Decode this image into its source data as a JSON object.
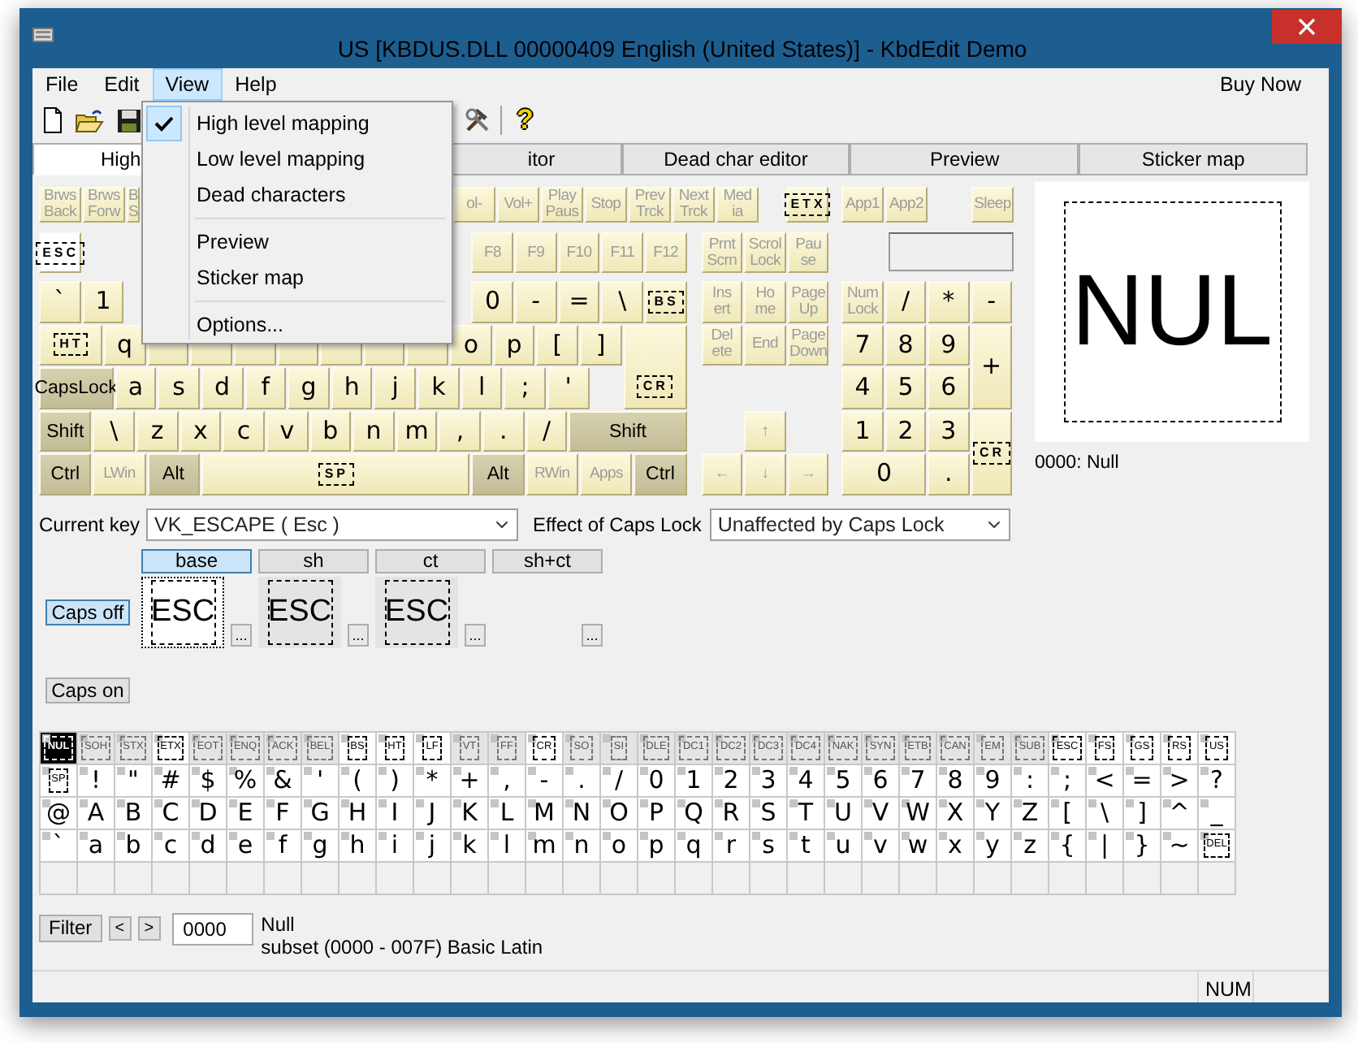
{
  "window": {
    "title": "US [KBDUS.DLL 00000409 English (United States)] - KbdEdit Demo"
  },
  "menu_bar": [
    {
      "label": "File",
      "selected": false
    },
    {
      "label": "Edit",
      "selected": false
    },
    {
      "label": "View",
      "selected": true
    },
    {
      "label": "Help",
      "selected": false
    }
  ],
  "buy_now": "Buy Now",
  "toolbar": {
    "help": "?"
  },
  "view_menu": [
    {
      "kind": "item",
      "label": "High level mapping",
      "checked": true
    },
    {
      "kind": "item",
      "label": "Low level mapping",
      "checked": false
    },
    {
      "kind": "item",
      "label": "Dead characters",
      "checked": false
    },
    {
      "kind": "separator"
    },
    {
      "kind": "item",
      "label": "Preview",
      "checked": false
    },
    {
      "kind": "item",
      "label": "Sticker map",
      "checked": false
    },
    {
      "kind": "separator"
    },
    {
      "kind": "item",
      "label": "Options...",
      "checked": false
    }
  ],
  "tabs": [
    {
      "label": "High",
      "selected": true
    },
    {
      "label": "itor",
      "selected": false
    },
    {
      "label": "Dead char editor",
      "selected": false
    },
    {
      "label": "Preview",
      "selected": false
    },
    {
      "label": "Sticker map",
      "selected": false
    }
  ],
  "keyboard": {
    "media_row": {
      "before_menu": [
        {
          "label": "Brws Back",
          "kind": "dim",
          "selected": false
        },
        {
          "label": "Brws Forw",
          "kind": "dim",
          "selected": false
        },
        {
          "label": "B S",
          "kind": "dim",
          "selected": false
        }
      ],
      "after_menu": [
        {
          "label": "ol-",
          "kind": "dim",
          "selected": false
        },
        {
          "label": "Vol+",
          "kind": "dim",
          "selected": false
        },
        {
          "label": "Play Paus",
          "kind": "dim",
          "selected": false
        },
        {
          "label": "Stop",
          "kind": "dim",
          "selected": false
        },
        {
          "label": "Prev Trck",
          "kind": "dim",
          "selected": false
        },
        {
          "label": "Next Trck",
          "kind": "dim",
          "selected": false
        },
        {
          "label": "Med ia",
          "kind": "dim",
          "selected": false
        }
      ],
      "nav": [
        {
          "label": "ETX",
          "kind": "sticker",
          "selected": false
        }
      ],
      "numpad": [
        {
          "label": "App1",
          "kind": "dim",
          "selected": false
        },
        {
          "label": "App2",
          "kind": "dim",
          "selected": false
        },
        {
          "label": "Sleep",
          "kind": "dim",
          "selected": false
        }
      ]
    },
    "main_rows": [
      {
        "keys": [
          {
            "label": "ESC",
            "kind": "sticker",
            "selected": true
          }
        ],
        "keys_after_menu": [
          {
            "label": "F8",
            "kind": "dim",
            "selected": false
          },
          {
            "label": "F9",
            "kind": "dim",
            "selected": false
          },
          {
            "label": "F10",
            "kind": "dim",
            "selected": false
          },
          {
            "label": "F11",
            "kind": "dim",
            "selected": false
          },
          {
            "label": "F12",
            "kind": "dim",
            "selected": false
          }
        ]
      },
      {
        "keys": [
          {
            "label": "`",
            "kind": "char",
            "selected": false
          },
          {
            "label": "1",
            "kind": "char",
            "selected": false
          }
        ],
        "keys_after_menu": [
          {
            "label": "0",
            "kind": "char",
            "selected": false
          },
          {
            "label": "-",
            "kind": "char",
            "selected": false
          },
          {
            "label": "=",
            "kind": "char",
            "selected": false
          },
          {
            "label": "\\",
            "kind": "char",
            "selected": false
          },
          {
            "label": "BS",
            "kind": "sticker",
            "selected": false
          }
        ]
      },
      {
        "keys": [
          {
            "label": "HT",
            "kind": "sticker",
            "selected": false
          },
          {
            "label": "q",
            "kind": "char",
            "selected": false
          },
          {
            "kind": "char",
            "selected": false
          },
          {
            "kind": "char",
            "selected": false
          },
          {
            "kind": "char",
            "selected": false
          },
          {
            "kind": "char",
            "selected": false
          },
          {
            "kind": "char",
            "selected": false
          },
          {
            "kind": "char",
            "selected": false
          },
          {
            "kind": "char",
            "selected": false
          },
          {
            "label": "o",
            "kind": "char",
            "selected": false
          },
          {
            "label": "p",
            "kind": "char",
            "selected": false
          },
          {
            "label": "[",
            "kind": "char",
            "selected": false
          },
          {
            "label": "]",
            "kind": "char",
            "selected": false
          },
          {
            "label": "CR",
            "kind": "sticker",
            "selected": false
          }
        ]
      },
      {
        "keys": [
          {
            "label": "CapsLock",
            "kind": "mod",
            "selected": false
          },
          {
            "label": "a",
            "kind": "char",
            "selected": false
          },
          {
            "label": "s",
            "kind": "char",
            "selected": false
          },
          {
            "label": "d",
            "kind": "char",
            "selected": false
          },
          {
            "label": "f",
            "kind": "char",
            "selected": false
          },
          {
            "label": "g",
            "kind": "char",
            "selected": false
          },
          {
            "label": "h",
            "kind": "char",
            "selected": false
          },
          {
            "label": "j",
            "kind": "char",
            "selected": false
          },
          {
            "label": "k",
            "kind": "char",
            "selected": false
          },
          {
            "label": "l",
            "kind": "char",
            "selected": false
          },
          {
            "label": ";",
            "kind": "char",
            "selected": false
          },
          {
            "label": "'",
            "kind": "char",
            "selected": false
          }
        ]
      },
      {
        "keys": [
          {
            "label": "Shift",
            "kind": "mod",
            "selected": false
          },
          {
            "label": "\\",
            "kind": "char",
            "selected": false
          },
          {
            "label": "z",
            "kind": "char",
            "selected": false
          },
          {
            "label": "x",
            "kind": "char",
            "selected": false
          },
          {
            "label": "c",
            "kind": "char",
            "selected": false
          },
          {
            "label": "v",
            "kind": "char",
            "selected": false
          },
          {
            "label": "b",
            "kind": "char",
            "selected": false
          },
          {
            "label": "n",
            "kind": "char",
            "selected": false
          },
          {
            "label": "m",
            "kind": "char",
            "selected": false
          },
          {
            "label": ",",
            "kind": "char",
            "selected": false
          },
          {
            "label": ".",
            "kind": "char",
            "selected": false
          },
          {
            "label": "/",
            "kind": "char",
            "selected": false
          },
          {
            "label": "Shift",
            "kind": "mod",
            "selected": false
          }
        ]
      },
      {
        "keys": [
          {
            "label": "Ctrl",
            "kind": "mod",
            "selected": false
          },
          {
            "label": "LWin",
            "kind": "dim",
            "selected": false
          },
          {
            "label": "Alt",
            "kind": "mod",
            "selected": false
          },
          {
            "label": "SP",
            "kind": "sticker",
            "selected": false
          },
          {
            "label": "Alt",
            "kind": "mod",
            "selected": false
          },
          {
            "label": "RWin",
            "kind": "dim",
            "selected": false
          },
          {
            "label": "Apps",
            "kind": "dim",
            "selected": false
          },
          {
            "label": "Ctrl",
            "kind": "mod",
            "selected": false
          }
        ]
      }
    ],
    "nav_rows": [
      [
        {
          "label": "Prnt Scrn",
          "kind": "dim",
          "selected": false
        },
        {
          "label": "Scrol Lock",
          "kind": "dim",
          "selected": false
        },
        {
          "label": "Pau se",
          "kind": "dim",
          "selected": false
        }
      ],
      [
        {
          "label": "Ins ert",
          "kind": "dim",
          "selected": false
        },
        {
          "label": "Ho me",
          "kind": "dim",
          "selected": false
        },
        {
          "label": "Page Up",
          "kind": "dim",
          "selected": false
        }
      ],
      [
        {
          "label": "Del ete",
          "kind": "dim",
          "selected": false
        },
        {
          "label": "End",
          "kind": "dim",
          "selected": false
        },
        {
          "label": "Page Down",
          "kind": "dim",
          "selected": false
        }
      ]
    ],
    "arrows": [
      {
        "label": "↑",
        "kind": "dim",
        "selected": false
      },
      {
        "label": "←",
        "kind": "dim",
        "selected": false
      },
      {
        "label": "↓",
        "kind": "dim",
        "selected": false
      },
      {
        "label": "→",
        "kind": "dim",
        "selected": false
      }
    ],
    "numpad_rows": [
      [
        {
          "label": "Num Lock",
          "kind": "dim",
          "selected": false
        },
        {
          "label": "/",
          "kind": "char",
          "selected": false
        },
        {
          "label": "*",
          "kind": "char",
          "selected": false
        },
        {
          "label": "-",
          "kind": "char",
          "selected": false
        }
      ],
      [
        {
          "label": "7",
          "kind": "char",
          "selected": false
        },
        {
          "label": "8",
          "kind": "char",
          "selected": false
        },
        {
          "label": "9",
          "kind": "char",
          "selected": false
        },
        {
          "label": "+",
          "kind": "char",
          "selected": false
        }
      ],
      [
        {
          "label": "4",
          "kind": "char",
          "selected": false
        },
        {
          "label": "5",
          "kind": "char",
          "selected": false
        },
        {
          "label": "6",
          "kind": "char",
          "selected": false
        }
      ],
      [
        {
          "label": "1",
          "kind": "char",
          "selected": false
        },
        {
          "label": "2",
          "kind": "char",
          "selected": false
        },
        {
          "label": "3",
          "kind": "char",
          "selected": false
        },
        {
          "label": "CR",
          "kind": "sticker",
          "selected": false
        }
      ],
      [
        {
          "label": "0",
          "kind": "char",
          "selected": false
        },
        {
          "label": ".",
          "kind": "char",
          "selected": false
        }
      ]
    ]
  },
  "preview": {
    "glyph": "NUL",
    "caption": "0000: Null"
  },
  "key_info": {
    "current_key_label": "Current key",
    "current_key": "VK_ESCAPE ( Esc )",
    "caps_effect_label": "Effect of Caps Lock",
    "caps_effect": "Unaffected by Caps Lock"
  },
  "shift_states": [
    {
      "label": "base",
      "selected": true
    },
    {
      "label": "sh",
      "selected": false
    },
    {
      "label": "ct",
      "selected": false
    },
    {
      "label": "sh+ct",
      "selected": false
    }
  ],
  "caps_rows": [
    {
      "label": "Caps off",
      "selected": true,
      "cells": [
        {
          "glyph": "ESC",
          "more": "...",
          "selected": true
        },
        {
          "glyph": "ESC",
          "more": "...",
          "selected": false
        },
        {
          "glyph": "ESC",
          "more": "...",
          "selected": false
        },
        {
          "more": "...",
          "selected": false
        }
      ]
    },
    {
      "label": "Caps on",
      "selected": false
    }
  ],
  "char_map": {
    "rows": [
      [
        {
          "label": "NUL",
          "kind": "sticker",
          "mapped": false,
          "selected": true
        },
        {
          "label": "SOH",
          "kind": "sticker",
          "mapped": false,
          "selected": false
        },
        {
          "label": "STX",
          "kind": "sticker",
          "mapped": false,
          "selected": false
        },
        {
          "label": "ETX",
          "kind": "sticker",
          "mapped": true,
          "selected": false
        },
        {
          "label": "EOT",
          "kind": "sticker",
          "mapped": false,
          "selected": false
        },
        {
          "label": "ENQ",
          "kind": "sticker",
          "mapped": false,
          "selected": false
        },
        {
          "label": "ACK",
          "kind": "sticker",
          "mapped": false,
          "selected": false
        },
        {
          "label": "BEL",
          "kind": "sticker",
          "mapped": false,
          "selected": false
        },
        {
          "label": "BS",
          "kind": "sticker",
          "mapped": true,
          "selected": false
        },
        {
          "label": "HT",
          "kind": "sticker",
          "mapped": true,
          "selected": false
        },
        {
          "label": "LF",
          "kind": "sticker",
          "mapped": true,
          "selected": false
        },
        {
          "label": "VT",
          "kind": "sticker",
          "mapped": false,
          "selected": false
        },
        {
          "label": "FF",
          "kind": "sticker",
          "mapped": false,
          "selected": false
        },
        {
          "label": "CR",
          "kind": "sticker",
          "mapped": true,
          "selected": false
        },
        {
          "label": "SO",
          "kind": "sticker",
          "mapped": false,
          "selected": false
        },
        {
          "label": "SI",
          "kind": "sticker",
          "mapped": false,
          "selected": false
        },
        {
          "label": "DLE",
          "kind": "sticker",
          "mapped": false,
          "selected": false
        },
        {
          "label": "DC1",
          "kind": "sticker",
          "mapped": false,
          "selected": false
        },
        {
          "label": "DC2",
          "kind": "sticker",
          "mapped": false,
          "selected": false
        },
        {
          "label": "DC3",
          "kind": "sticker",
          "mapped": false,
          "selected": false
        },
        {
          "label": "DC4",
          "kind": "sticker",
          "mapped": false,
          "selected": false
        },
        {
          "label": "NAK",
          "kind": "sticker",
          "mapped": false,
          "selected": false
        },
        {
          "label": "SYN",
          "kind": "sticker",
          "mapped": false,
          "selected": false
        },
        {
          "label": "ETB",
          "kind": "sticker",
          "mapped": false,
          "selected": false
        },
        {
          "label": "CAN",
          "kind": "sticker",
          "mapped": false,
          "selected": false
        },
        {
          "label": "EM",
          "kind": "sticker",
          "mapped": false,
          "selected": false
        },
        {
          "label": "SUB",
          "kind": "sticker",
          "mapped": false,
          "selected": false
        },
        {
          "label": "ESC",
          "kind": "sticker",
          "mapped": true,
          "selected": false
        },
        {
          "label": "FS",
          "kind": "sticker",
          "mapped": true,
          "selected": false
        },
        {
          "label": "GS",
          "kind": "sticker",
          "mapped": true,
          "selected": false
        },
        {
          "label": "RS",
          "kind": "sticker",
          "mapped": true,
          "selected": false
        },
        {
          "label": "US",
          "kind": "sticker",
          "mapped": true,
          "selected": false
        }
      ],
      [
        {
          "label": "SP",
          "kind": "sticker",
          "mapped": true,
          "selected": false
        },
        {
          "label": "!",
          "kind": "char",
          "mapped": true,
          "selected": false
        },
        {
          "label": "\"",
          "kind": "char",
          "mapped": true,
          "selected": false
        },
        {
          "label": "#",
          "kind": "char",
          "mapped": true,
          "selected": false
        },
        {
          "label": "$",
          "kind": "char",
          "mapped": true,
          "selected": false
        },
        {
          "label": "%",
          "kind": "char",
          "mapped": true,
          "selected": false
        },
        {
          "label": "&",
          "kind": "char",
          "mapped": true,
          "selected": false
        },
        {
          "label": "'",
          "kind": "char",
          "mapped": true,
          "selected": false
        },
        {
          "label": "(",
          "kind": "char",
          "mapped": true,
          "selected": false
        },
        {
          "label": ")",
          "kind": "char",
          "mapped": true,
          "selected": false
        },
        {
          "label": "*",
          "kind": "char",
          "mapped": true,
          "selected": false
        },
        {
          "label": "+",
          "kind": "char",
          "mapped": true,
          "selected": false
        },
        {
          "label": ",",
          "kind": "char",
          "mapped": true,
          "selected": false
        },
        {
          "label": "-",
          "kind": "char",
          "mapped": true,
          "selected": false
        },
        {
          "label": ".",
          "kind": "char",
          "mapped": true,
          "selected": false
        },
        {
          "label": "/",
          "kind": "char",
          "mapped": true,
          "selected": false
        },
        {
          "label": "0",
          "kind": "char",
          "mapped": true,
          "selected": false
        },
        {
          "label": "1",
          "kind": "char",
          "mapped": true,
          "selected": false
        },
        {
          "label": "2",
          "kind": "char",
          "mapped": true,
          "selected": false
        },
        {
          "label": "3",
          "kind": "char",
          "mapped": true,
          "selected": false
        },
        {
          "label": "4",
          "kind": "char",
          "mapped": true,
          "selected": false
        },
        {
          "label": "5",
          "kind": "char",
          "mapped": true,
          "selected": false
        },
        {
          "label": "6",
          "kind": "char",
          "mapped": true,
          "selected": false
        },
        {
          "label": "7",
          "kind": "char",
          "mapped": true,
          "selected": false
        },
        {
          "label": "8",
          "kind": "char",
          "mapped": true,
          "selected": false
        },
        {
          "label": "9",
          "kind": "char",
          "mapped": true,
          "selected": false
        },
        {
          "label": ":",
          "kind": "char",
          "mapped": true,
          "selected": false
        },
        {
          "label": ";",
          "kind": "char",
          "mapped": true,
          "selected": false
        },
        {
          "label": "<",
          "kind": "char",
          "mapped": true,
          "selected": false
        },
        {
          "label": "=",
          "kind": "char",
          "mapped": true,
          "selected": false
        },
        {
          "label": ">",
          "kind": "char",
          "mapped": true,
          "selected": false
        },
        {
          "label": "?",
          "kind": "char",
          "mapped": true,
          "selected": false
        }
      ],
      [
        {
          "label": "@",
          "kind": "char",
          "mapped": true,
          "selected": false
        },
        {
          "label": "A",
          "kind": "char",
          "mapped": true,
          "selected": false
        },
        {
          "label": "B",
          "kind": "char",
          "mapped": true,
          "selected": false
        },
        {
          "label": "C",
          "kind": "char",
          "mapped": true,
          "selected": false
        },
        {
          "label": "D",
          "kind": "char",
          "mapped": true,
          "selected": false
        },
        {
          "label": "E",
          "kind": "char",
          "mapped": true,
          "selected": false
        },
        {
          "label": "F",
          "kind": "char",
          "mapped": true,
          "selected": false
        },
        {
          "label": "G",
          "kind": "char",
          "mapped": true,
          "selected": false
        },
        {
          "label": "H",
          "kind": "char",
          "mapped": true,
          "selected": false
        },
        {
          "label": "I",
          "kind": "char",
          "mapped": true,
          "selected": false
        },
        {
          "label": "J",
          "kind": "char",
          "mapped": true,
          "selected": false
        },
        {
          "label": "K",
          "kind": "char",
          "mapped": true,
          "selected": false
        },
        {
          "label": "L",
          "kind": "char",
          "mapped": true,
          "selected": false
        },
        {
          "label": "M",
          "kind": "char",
          "mapped": true,
          "selected": false
        },
        {
          "label": "N",
          "kind": "char",
          "mapped": true,
          "selected": false
        },
        {
          "label": "O",
          "kind": "char",
          "mapped": true,
          "selected": false
        },
        {
          "label": "P",
          "kind": "char",
          "mapped": true,
          "selected": false
        },
        {
          "label": "Q",
          "kind": "char",
          "mapped": true,
          "selected": false
        },
        {
          "label": "R",
          "kind": "char",
          "mapped": true,
          "selected": false
        },
        {
          "label": "S",
          "kind": "char",
          "mapped": true,
          "selected": false
        },
        {
          "label": "T",
          "kind": "char",
          "mapped": true,
          "selected": false
        },
        {
          "label": "U",
          "kind": "char",
          "mapped": true,
          "selected": false
        },
        {
          "label": "V",
          "kind": "char",
          "mapped": true,
          "selected": false
        },
        {
          "label": "W",
          "kind": "char",
          "mapped": true,
          "selected": false
        },
        {
          "label": "X",
          "kind": "char",
          "mapped": true,
          "selected": false
        },
        {
          "label": "Y",
          "kind": "char",
          "mapped": true,
          "selected": false
        },
        {
          "label": "Z",
          "kind": "char",
          "mapped": true,
          "selected": false
        },
        {
          "label": "[",
          "kind": "char",
          "mapped": true,
          "selected": false
        },
        {
          "label": "\\",
          "kind": "char",
          "mapped": true,
          "selected": false
        },
        {
          "label": "]",
          "kind": "char",
          "mapped": true,
          "selected": false
        },
        {
          "label": "^",
          "kind": "char",
          "mapped": true,
          "selected": false
        },
        {
          "label": "_",
          "kind": "char",
          "mapped": true,
          "selected": false
        }
      ],
      [
        {
          "label": "`",
          "kind": "char",
          "mapped": true,
          "selected": false
        },
        {
          "label": "a",
          "kind": "char",
          "mapped": true,
          "selected": false
        },
        {
          "label": "b",
          "kind": "char",
          "mapped": true,
          "selected": false
        },
        {
          "label": "c",
          "kind": "char",
          "mapped": true,
          "selected": false
        },
        {
          "label": "d",
          "kind": "char",
          "mapped": true,
          "selected": false
        },
        {
          "label": "e",
          "kind": "char",
          "mapped": true,
          "selected": false
        },
        {
          "label": "f",
          "kind": "char",
          "mapped": true,
          "selected": false
        },
        {
          "label": "g",
          "kind": "char",
          "mapped": true,
          "selected": false
        },
        {
          "label": "h",
          "kind": "char",
          "mapped": true,
          "selected": false
        },
        {
          "label": "i",
          "kind": "char",
          "mapped": true,
          "selected": false
        },
        {
          "label": "j",
          "kind": "char",
          "mapped": true,
          "selected": false
        },
        {
          "label": "k",
          "kind": "char",
          "mapped": true,
          "selected": false
        },
        {
          "label": "l",
          "kind": "char",
          "mapped": true,
          "selected": false
        },
        {
          "label": "m",
          "kind": "char",
          "mapped": true,
          "selected": false
        },
        {
          "label": "n",
          "kind": "char",
          "mapped": true,
          "selected": false
        },
        {
          "label": "o",
          "kind": "char",
          "mapped": true,
          "selected": false
        },
        {
          "label": "p",
          "kind": "char",
          "mapped": true,
          "selected": false
        },
        {
          "label": "q",
          "kind": "char",
          "mapped": true,
          "selected": false
        },
        {
          "label": "r",
          "kind": "char",
          "mapped": true,
          "selected": false
        },
        {
          "label": "s",
          "kind": "char",
          "mapped": true,
          "selected": false
        },
        {
          "label": "t",
          "kind": "char",
          "mapped": true,
          "selected": false
        },
        {
          "label": "u",
          "kind": "char",
          "mapped": true,
          "selected": false
        },
        {
          "label": "v",
          "kind": "char",
          "mapped": true,
          "selected": false
        },
        {
          "label": "w",
          "kind": "char",
          "mapped": true,
          "selected": false
        },
        {
          "label": "x",
          "kind": "char",
          "mapped": true,
          "selected": false
        },
        {
          "label": "y",
          "kind": "char",
          "mapped": true,
          "selected": false
        },
        {
          "label": "z",
          "kind": "char",
          "mapped": true,
          "selected": false
        },
        {
          "label": "{",
          "kind": "char",
          "mapped": true,
          "selected": false
        },
        {
          "label": "|",
          "kind": "char",
          "mapped": true,
          "selected": false
        },
        {
          "label": "}",
          "kind": "char",
          "mapped": true,
          "selected": false
        },
        {
          "label": "~",
          "kind": "char",
          "mapped": true,
          "selected": false
        },
        {
          "label": "DEL",
          "kind": "sticker",
          "mapped": true,
          "selected": false
        }
      ],
      []
    ]
  },
  "filter": {
    "button": "Filter",
    "prev": "<",
    "next": ">",
    "code": "0000",
    "name": "Null",
    "subset": "subset (0000 - 007F) Basic Latin"
  },
  "status_bar": [
    "NUM"
  ]
}
